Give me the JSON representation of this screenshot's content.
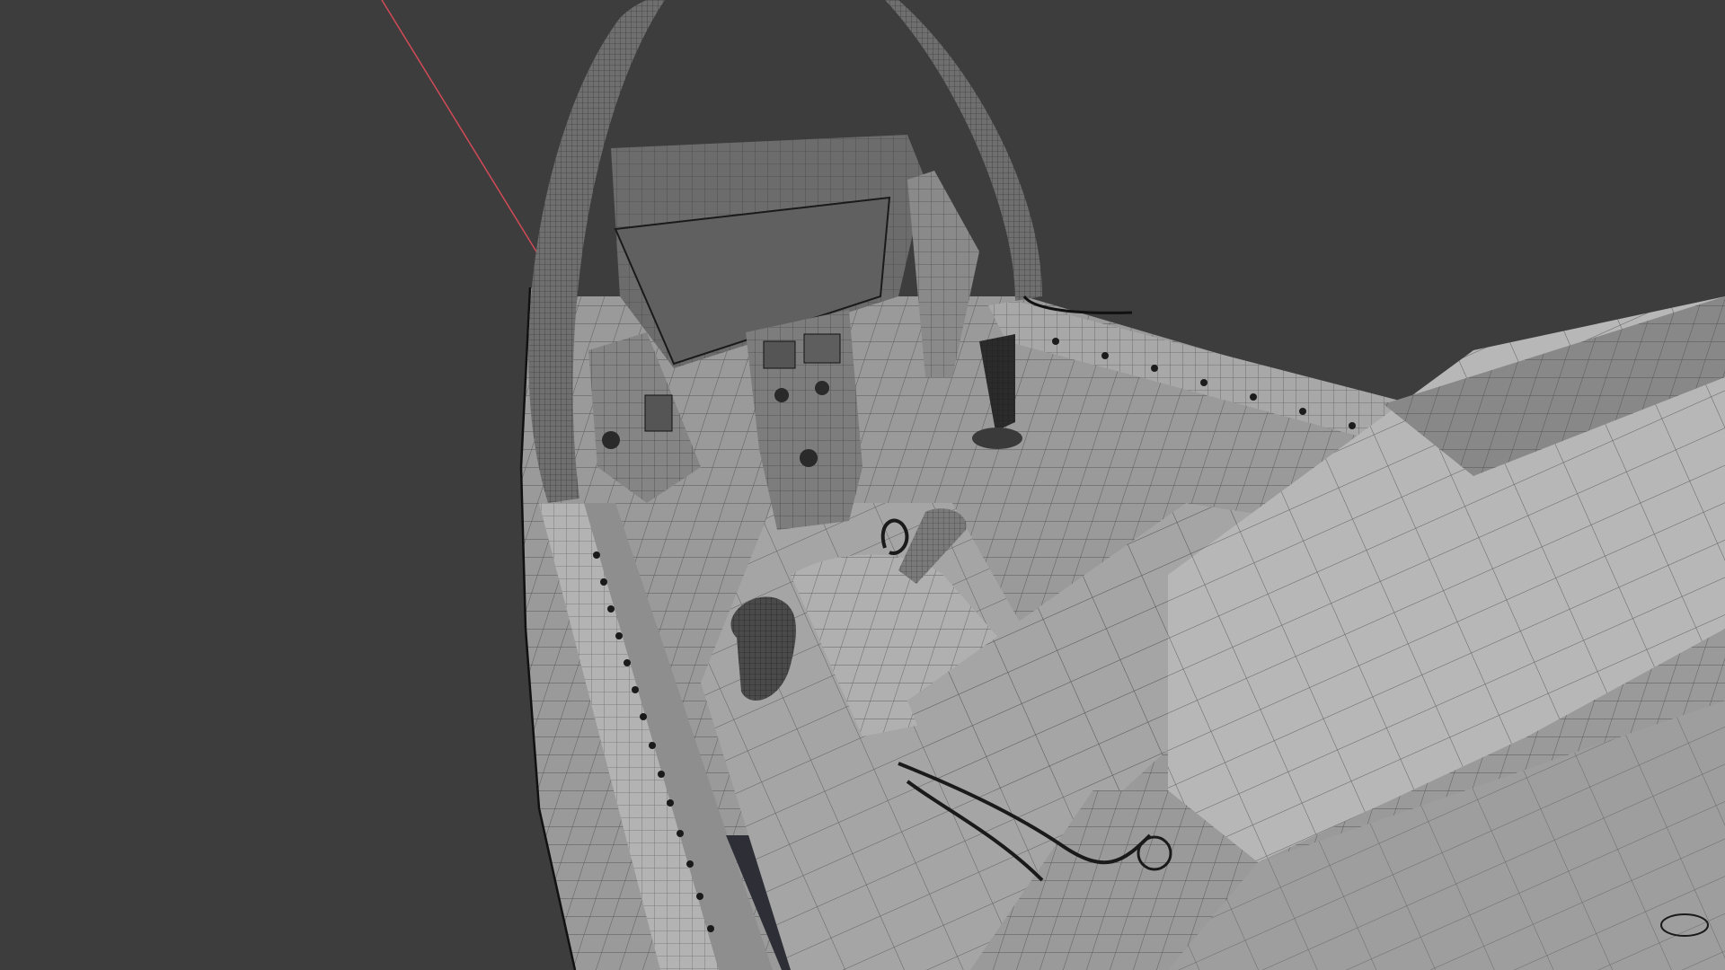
{
  "viewport": {
    "shading_mode": "solid-wireframe-overlay",
    "background_color": "#3d3d3d",
    "axis_x_color": "#d14a57",
    "mesh_face_color": "#9d9d9d",
    "mesh_dark_color": "#595959",
    "mesh_light_color": "#bdbdbd",
    "wire_color": "#161616"
  },
  "scene": {
    "subject": "aircraft-cockpit-mesh"
  }
}
